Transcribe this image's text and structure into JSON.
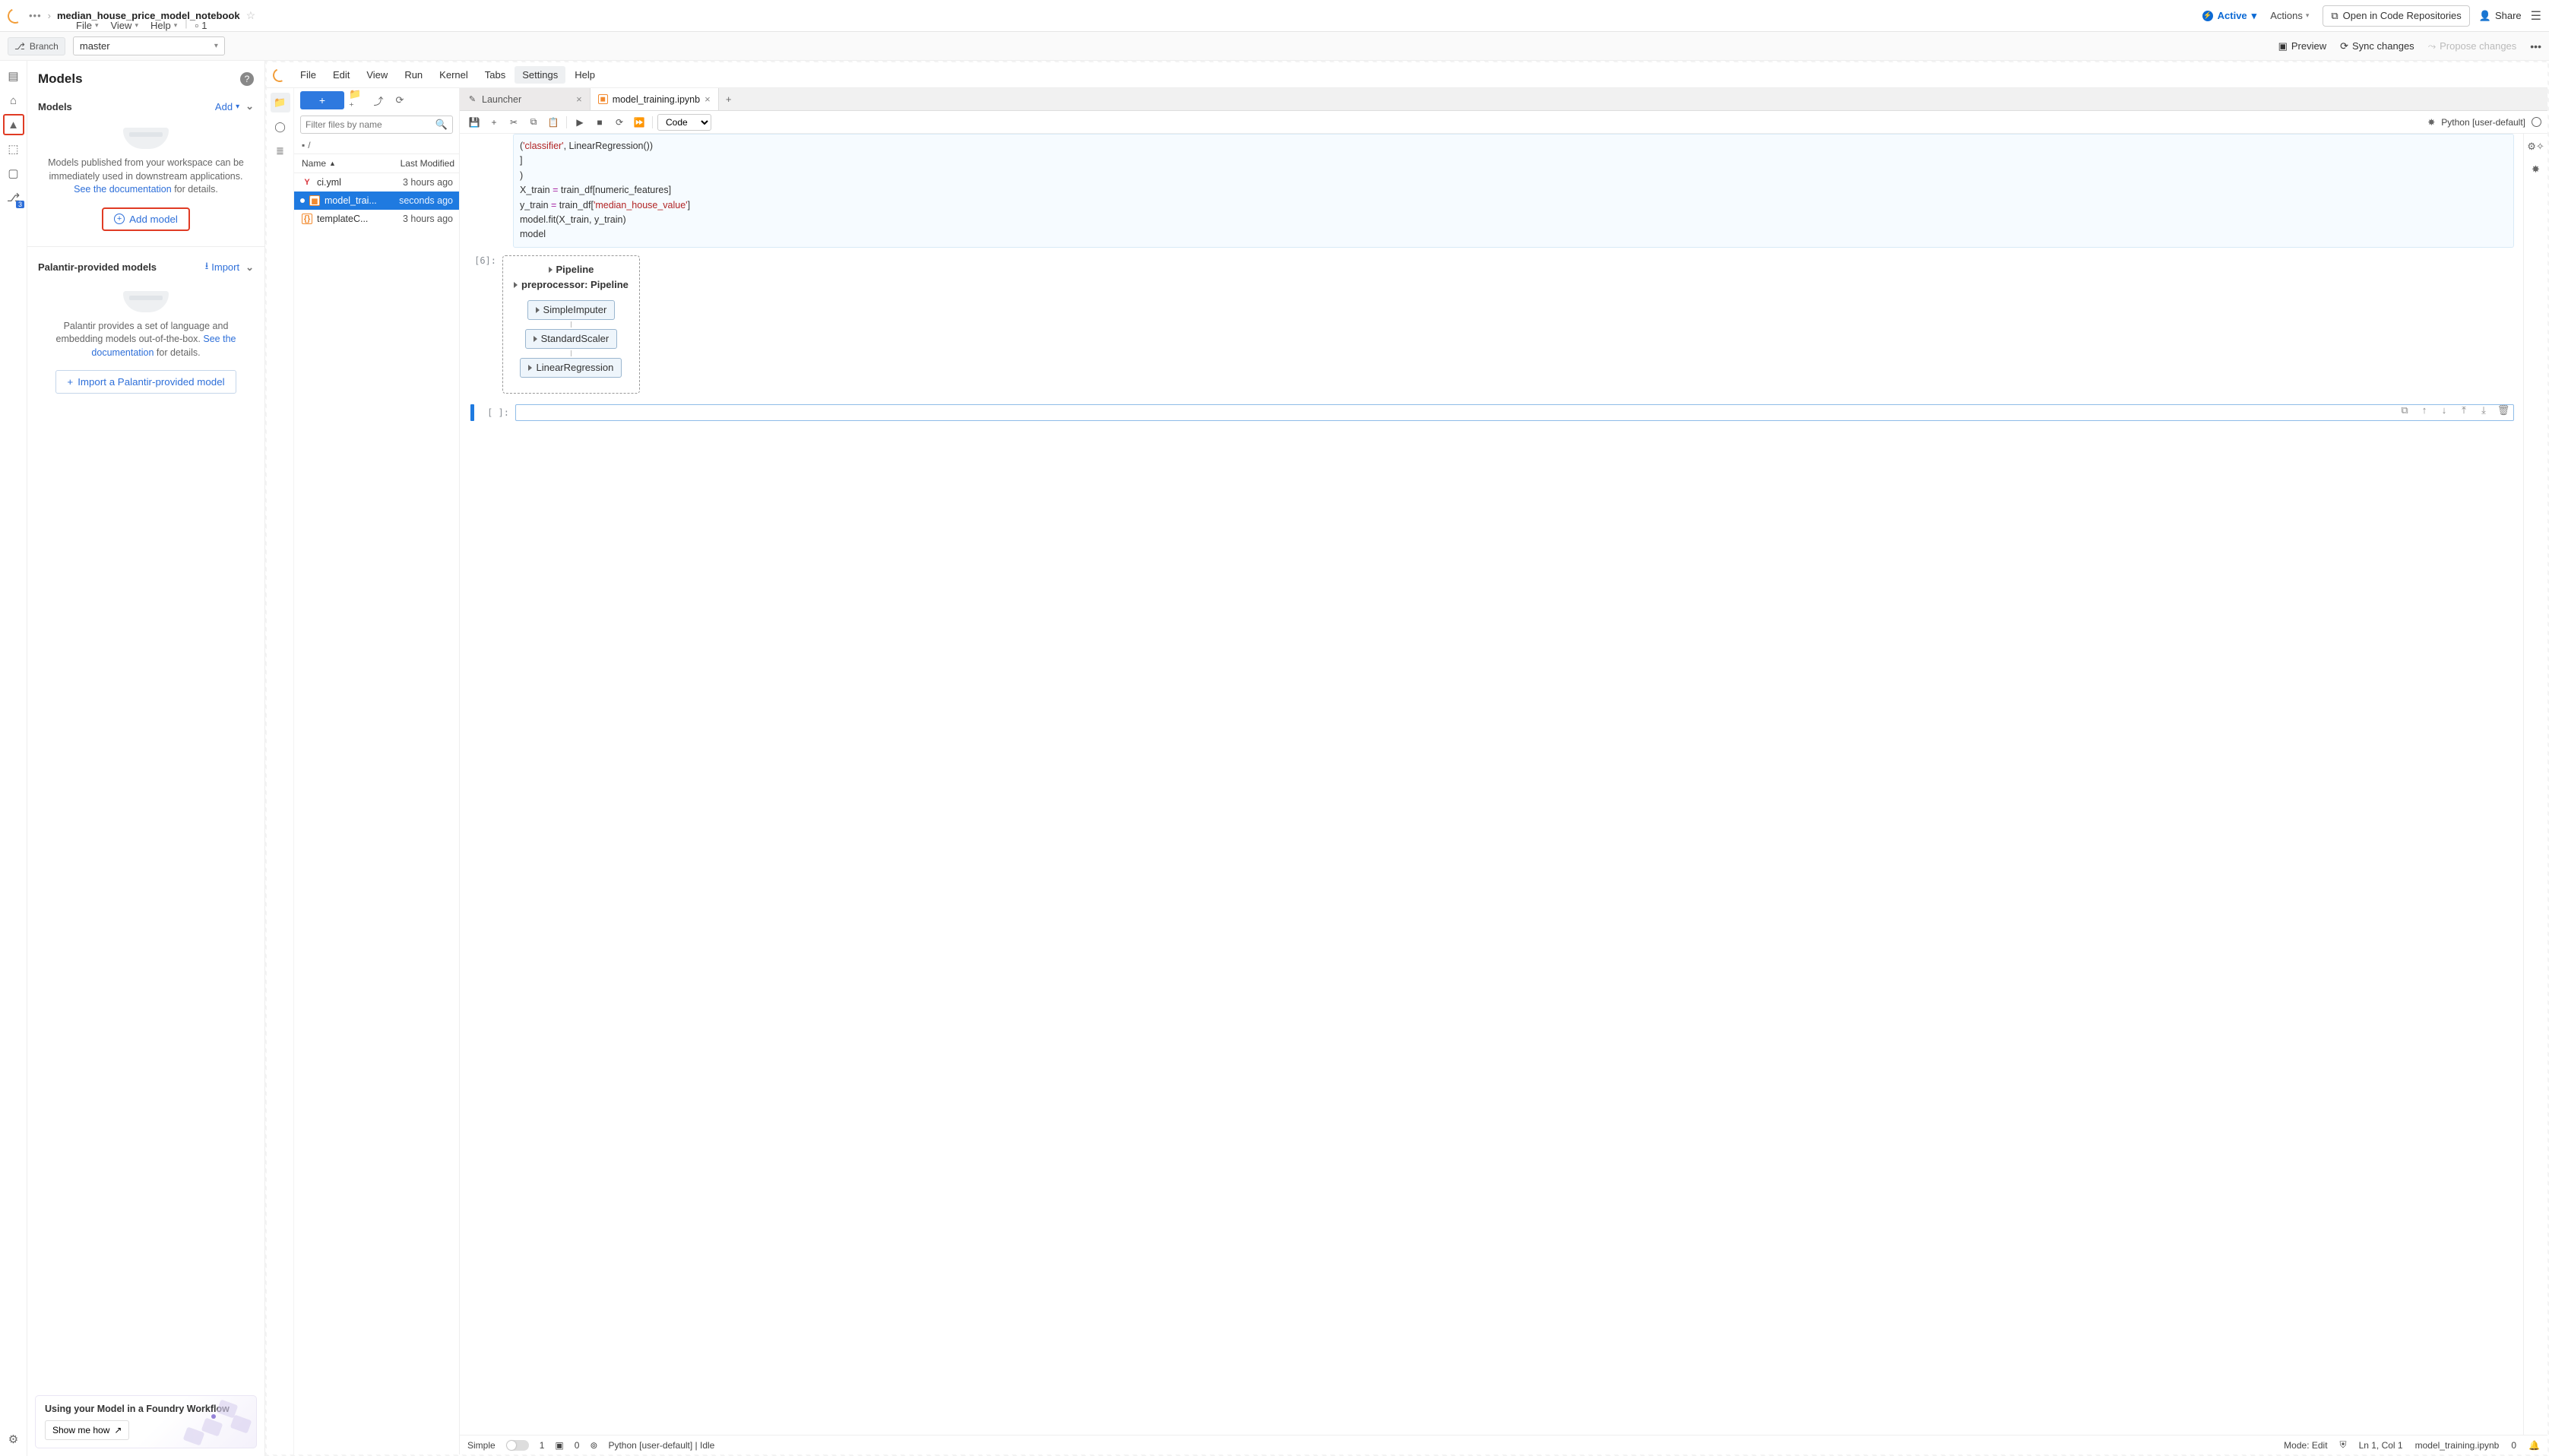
{
  "breadcrumb": {
    "dots": "•••",
    "title": "median_house_price_model_notebook"
  },
  "topMenus": {
    "file": "File",
    "view": "View",
    "help": "Help",
    "badge": "1"
  },
  "topRight": {
    "active": "Active",
    "actions": "Actions",
    "openRepos": "Open in Code Repositories",
    "share": "Share"
  },
  "secbar": {
    "branchLabel": "Branch",
    "branchValue": "master",
    "preview": "Preview",
    "sync": "Sync changes",
    "propose": "Propose changes"
  },
  "leftIcons": {
    "badge": "3"
  },
  "sidePanel": {
    "title": "Models",
    "models": {
      "header": "Models",
      "addLink": "Add",
      "desc1": "Models published from your workspace can be immediately used in downstream applications. ",
      "docLink": "See the documentation",
      "desc2": " for details.",
      "addBtn": "Add model"
    },
    "palantir": {
      "header": "Palantir-provided models",
      "importLink": "Import",
      "desc1": "Palantir provides a set of language and embedding models out-of-the-box. ",
      "docLink": "See the documentation",
      "desc2": " for details.",
      "importBtn": "Import a Palantir-provided model"
    },
    "footer": {
      "title": "Using your Model in a Foundry Workflow",
      "btn": "Show me how"
    }
  },
  "wsMenu": [
    "File",
    "Edit",
    "View",
    "Run",
    "Kernel",
    "Tabs",
    "Settings",
    "Help"
  ],
  "wsMenuActive": "Settings",
  "filePanel": {
    "searchPlaceholder": "Filter files by name",
    "path": "/",
    "colName": "Name",
    "colMod": "Last Modified",
    "rows": [
      {
        "icon": "Y",
        "cls": "fi-y",
        "name": "ci.yml",
        "mod": "3 hours ago",
        "sel": false
      },
      {
        "icon": "◼",
        "cls": "fi-o",
        "name": "model_trai...",
        "mod": "seconds ago",
        "sel": true,
        "dirty": true
      },
      {
        "icon": "{}",
        "cls": "fi-c",
        "name": "templateC...",
        "mod": "3 hours ago",
        "sel": false
      }
    ]
  },
  "tabs": {
    "launcher": "Launcher",
    "active": "model_training.ipynb"
  },
  "nbToolbar": {
    "cellType": "Code",
    "kernel": "Python [user-default]"
  },
  "code": {
    "l1a": "        (",
    "l1b": "'classifier'",
    "l1c": ", LinearRegression())",
    "l2": "    ]",
    "l3": ")",
    "l4a": "X_train ",
    "l4b": "=",
    "l4c": " train_df[numeric_features]",
    "l5a": "y_train ",
    "l5b": "=",
    "l5c": " train_df[",
    "l5d": "'median_house_value'",
    "l5e": "]",
    "l6": "model.fit(X_train, y_train)",
    "l7": "model"
  },
  "output": {
    "prompt": "[6]:",
    "title": "Pipeline",
    "sub": "preprocessor: Pipeline",
    "steps": [
      "SimpleImputer",
      "StandardScaler",
      "LinearRegression"
    ]
  },
  "emptyPrompt": "[ ]:",
  "status": {
    "simple": "Simple",
    "one": "1",
    "zero": "0",
    "kernel": "Python [user-default] | Idle",
    "mode": "Mode: Edit",
    "pos": "Ln 1, Col 1",
    "file": "model_training.ipynb",
    "zero2": "0"
  }
}
